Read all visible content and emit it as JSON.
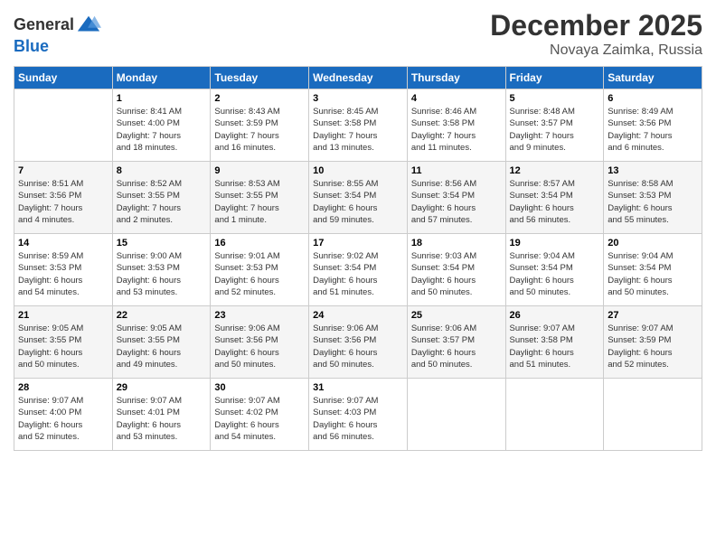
{
  "header": {
    "logo_line1": "General",
    "logo_line2": "Blue",
    "month": "December 2025",
    "location": "Novaya Zaimka, Russia"
  },
  "days_of_week": [
    "Sunday",
    "Monday",
    "Tuesday",
    "Wednesday",
    "Thursday",
    "Friday",
    "Saturday"
  ],
  "weeks": [
    [
      {
        "num": "",
        "info": ""
      },
      {
        "num": "1",
        "info": "Sunrise: 8:41 AM\nSunset: 4:00 PM\nDaylight: 7 hours\nand 18 minutes."
      },
      {
        "num": "2",
        "info": "Sunrise: 8:43 AM\nSunset: 3:59 PM\nDaylight: 7 hours\nand 16 minutes."
      },
      {
        "num": "3",
        "info": "Sunrise: 8:45 AM\nSunset: 3:58 PM\nDaylight: 7 hours\nand 13 minutes."
      },
      {
        "num": "4",
        "info": "Sunrise: 8:46 AM\nSunset: 3:58 PM\nDaylight: 7 hours\nand 11 minutes."
      },
      {
        "num": "5",
        "info": "Sunrise: 8:48 AM\nSunset: 3:57 PM\nDaylight: 7 hours\nand 9 minutes."
      },
      {
        "num": "6",
        "info": "Sunrise: 8:49 AM\nSunset: 3:56 PM\nDaylight: 7 hours\nand 6 minutes."
      }
    ],
    [
      {
        "num": "7",
        "info": "Sunrise: 8:51 AM\nSunset: 3:56 PM\nDaylight: 7 hours\nand 4 minutes."
      },
      {
        "num": "8",
        "info": "Sunrise: 8:52 AM\nSunset: 3:55 PM\nDaylight: 7 hours\nand 2 minutes."
      },
      {
        "num": "9",
        "info": "Sunrise: 8:53 AM\nSunset: 3:55 PM\nDaylight: 7 hours\nand 1 minute."
      },
      {
        "num": "10",
        "info": "Sunrise: 8:55 AM\nSunset: 3:54 PM\nDaylight: 6 hours\nand 59 minutes."
      },
      {
        "num": "11",
        "info": "Sunrise: 8:56 AM\nSunset: 3:54 PM\nDaylight: 6 hours\nand 57 minutes."
      },
      {
        "num": "12",
        "info": "Sunrise: 8:57 AM\nSunset: 3:54 PM\nDaylight: 6 hours\nand 56 minutes."
      },
      {
        "num": "13",
        "info": "Sunrise: 8:58 AM\nSunset: 3:53 PM\nDaylight: 6 hours\nand 55 minutes."
      }
    ],
    [
      {
        "num": "14",
        "info": "Sunrise: 8:59 AM\nSunset: 3:53 PM\nDaylight: 6 hours\nand 54 minutes."
      },
      {
        "num": "15",
        "info": "Sunrise: 9:00 AM\nSunset: 3:53 PM\nDaylight: 6 hours\nand 53 minutes."
      },
      {
        "num": "16",
        "info": "Sunrise: 9:01 AM\nSunset: 3:53 PM\nDaylight: 6 hours\nand 52 minutes."
      },
      {
        "num": "17",
        "info": "Sunrise: 9:02 AM\nSunset: 3:54 PM\nDaylight: 6 hours\nand 51 minutes."
      },
      {
        "num": "18",
        "info": "Sunrise: 9:03 AM\nSunset: 3:54 PM\nDaylight: 6 hours\nand 50 minutes."
      },
      {
        "num": "19",
        "info": "Sunrise: 9:04 AM\nSunset: 3:54 PM\nDaylight: 6 hours\nand 50 minutes."
      },
      {
        "num": "20",
        "info": "Sunrise: 9:04 AM\nSunset: 3:54 PM\nDaylight: 6 hours\nand 50 minutes."
      }
    ],
    [
      {
        "num": "21",
        "info": "Sunrise: 9:05 AM\nSunset: 3:55 PM\nDaylight: 6 hours\nand 50 minutes."
      },
      {
        "num": "22",
        "info": "Sunrise: 9:05 AM\nSunset: 3:55 PM\nDaylight: 6 hours\nand 49 minutes."
      },
      {
        "num": "23",
        "info": "Sunrise: 9:06 AM\nSunset: 3:56 PM\nDaylight: 6 hours\nand 50 minutes."
      },
      {
        "num": "24",
        "info": "Sunrise: 9:06 AM\nSunset: 3:56 PM\nDaylight: 6 hours\nand 50 minutes."
      },
      {
        "num": "25",
        "info": "Sunrise: 9:06 AM\nSunset: 3:57 PM\nDaylight: 6 hours\nand 50 minutes."
      },
      {
        "num": "26",
        "info": "Sunrise: 9:07 AM\nSunset: 3:58 PM\nDaylight: 6 hours\nand 51 minutes."
      },
      {
        "num": "27",
        "info": "Sunrise: 9:07 AM\nSunset: 3:59 PM\nDaylight: 6 hours\nand 52 minutes."
      }
    ],
    [
      {
        "num": "28",
        "info": "Sunrise: 9:07 AM\nSunset: 4:00 PM\nDaylight: 6 hours\nand 52 minutes."
      },
      {
        "num": "29",
        "info": "Sunrise: 9:07 AM\nSunset: 4:01 PM\nDaylight: 6 hours\nand 53 minutes."
      },
      {
        "num": "30",
        "info": "Sunrise: 9:07 AM\nSunset: 4:02 PM\nDaylight: 6 hours\nand 54 minutes."
      },
      {
        "num": "31",
        "info": "Sunrise: 9:07 AM\nSunset: 4:03 PM\nDaylight: 6 hours\nand 56 minutes."
      },
      {
        "num": "",
        "info": ""
      },
      {
        "num": "",
        "info": ""
      },
      {
        "num": "",
        "info": ""
      }
    ]
  ]
}
